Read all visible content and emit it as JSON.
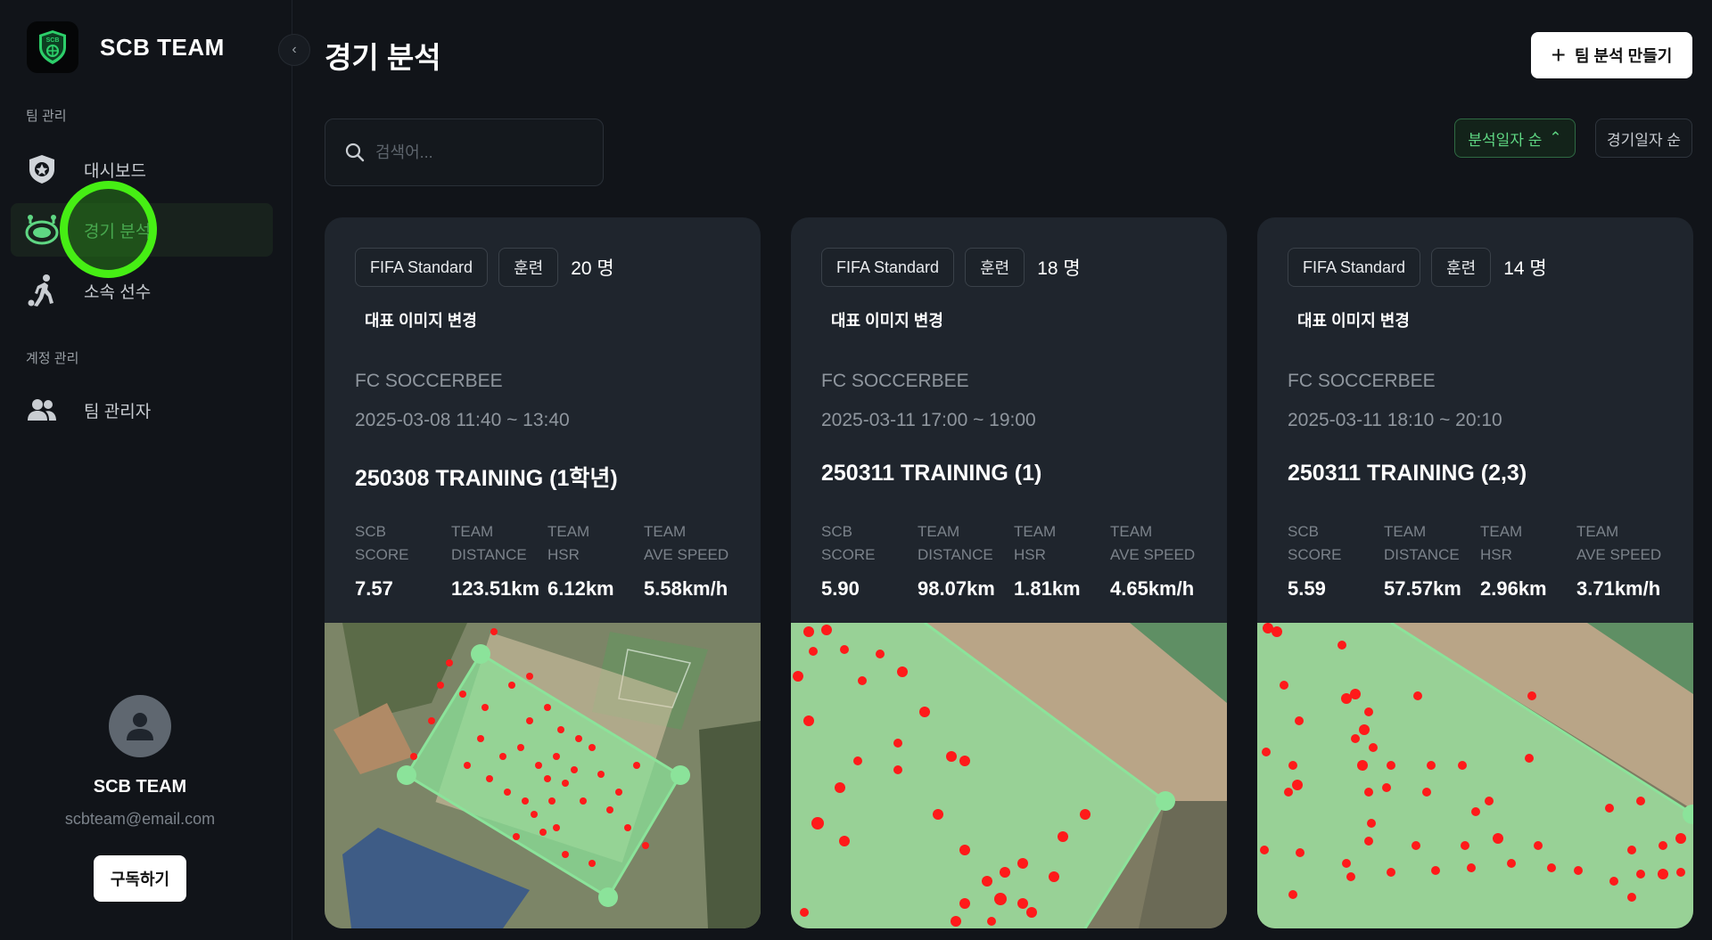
{
  "brand": {
    "name": "SCB TEAM",
    "logo_text": "SCB"
  },
  "sidebar": {
    "sections": [
      {
        "label": "팀 관리"
      },
      {
        "label": "계정 관리"
      }
    ],
    "items": [
      {
        "label": "대시보드",
        "icon": "shield-star-icon"
      },
      {
        "label": "경기 분석",
        "icon": "stadium-icon",
        "active": true
      },
      {
        "label": "소속 선수",
        "icon": "player-kick-icon"
      },
      {
        "label": "팀 관리자",
        "icon": "people-icon"
      }
    ]
  },
  "profile": {
    "name": "SCB TEAM",
    "email": "scbteam@email.com",
    "subscribe_label": "구독하기"
  },
  "main": {
    "title": "경기 분석",
    "create_label": "팀 분석 만들기",
    "search": {
      "placeholder": "검색어..."
    },
    "sort": [
      {
        "label": "분석일자 순",
        "active": true
      },
      {
        "label": "경기일자 순",
        "active": false
      }
    ]
  },
  "stat_labels": {
    "score": "SCB\nSCORE",
    "distance": "TEAM\nDISTANCE",
    "hsr": "TEAM\nHSR",
    "speed": "TEAM\nAVE SPEED"
  },
  "cards": [
    {
      "standard": "FIFA Standard",
      "type": "훈련",
      "count": "20 명",
      "change_image": "대표 이미지 변경",
      "team": "FC SOCCERBEE",
      "time": "2025-03-08 11:40 ~ 13:40",
      "title": "250308 TRAINING (1학년)",
      "score": "7.57",
      "distance": "123.51km",
      "hsr": "6.12km",
      "speed": "5.58km/h"
    },
    {
      "standard": "FIFA Standard",
      "type": "훈련",
      "count": "18 명",
      "change_image": "대표 이미지 변경",
      "team": "FC SOCCERBEE",
      "time": "2025-03-11 17:00 ~ 19:00",
      "title": "250311 TRAINING (1)",
      "score": "5.90",
      "distance": "98.07km",
      "hsr": "1.81km",
      "speed": "4.65km/h"
    },
    {
      "standard": "FIFA Standard",
      "type": "훈련",
      "count": "14 명",
      "change_image": "대표 이미지 변경",
      "team": "FC SOCCERBEE",
      "time": "2025-03-11 18:10 ~ 20:10",
      "title": "250311 TRAINING (2,3)",
      "score": "5.59",
      "distance": "57.57km",
      "hsr": "2.96km",
      "speed": "3.71km/h"
    }
  ],
  "colors": {
    "accent": "#5fd783",
    "highlight": "#46ee14",
    "field_overlay": "#8be39a",
    "player_dot": "#ff1a1a"
  }
}
